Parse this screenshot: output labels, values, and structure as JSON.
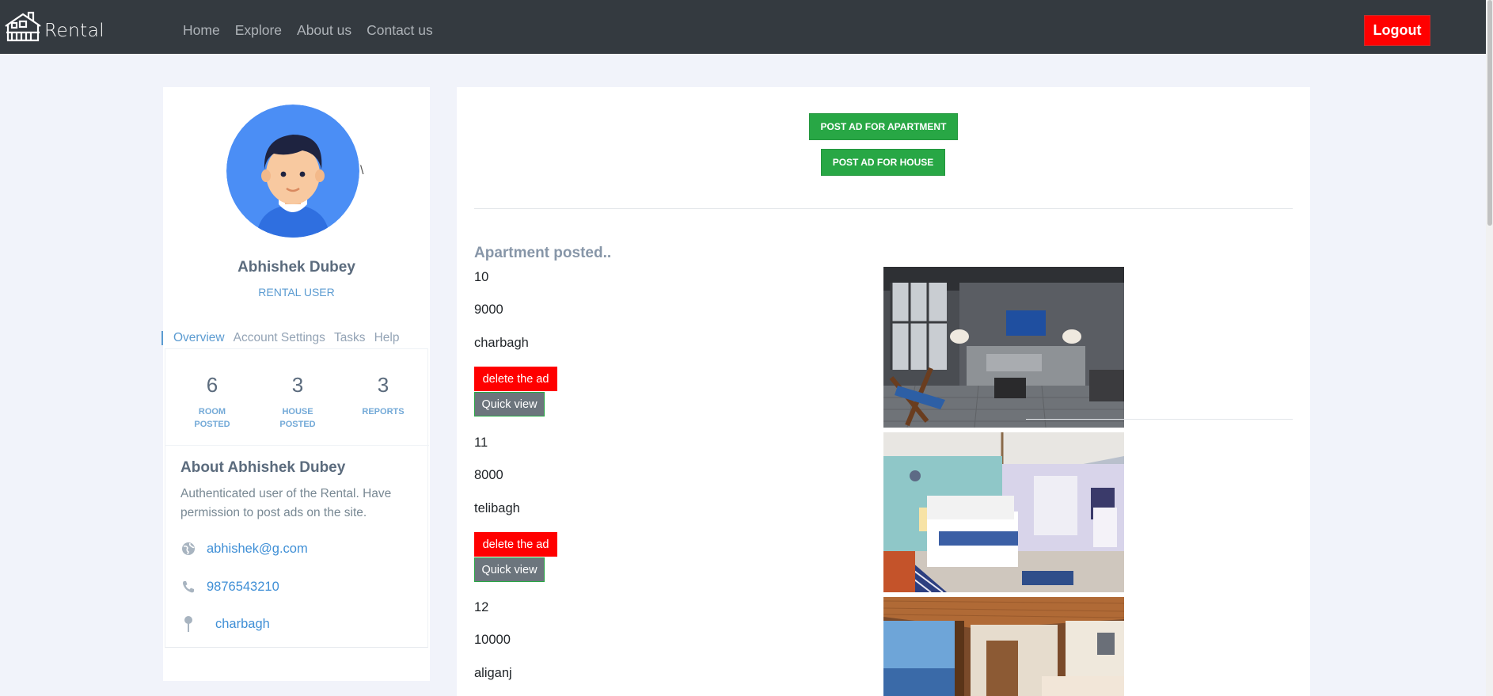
{
  "navbar": {
    "brand": "Rental",
    "links": [
      "Home",
      "Explore",
      "About us",
      "Contact us"
    ],
    "logout": "Logout"
  },
  "profile": {
    "mark": "\\",
    "name": "Abhishek Dubey",
    "role": "RENTAL USER",
    "menu": [
      "Overview",
      "Account Settings",
      "Tasks",
      "Help"
    ],
    "stats": [
      {
        "value": "6",
        "label_1": "ROOM",
        "label_2": "POSTED"
      },
      {
        "value": "3",
        "label_1": "HOUSE",
        "label_2": "POSTED"
      },
      {
        "value": "3",
        "label_1": "REPORTS",
        "label_2": ""
      }
    ],
    "about_title": "About Abhishek Dubey",
    "about_text": "Authenticated user of the Rental. Have permission to post ads on the site.",
    "email": "abhishek@g.com",
    "phone": "9876543210",
    "location": "charbagh"
  },
  "main": {
    "post_apartment": "POST AD FOR APARTMENT",
    "post_house": "POST AD FOR HOUSE",
    "section_title": "Apartment posted..",
    "delete_label": "delete the ad",
    "quick_label": "Quick view",
    "ads": [
      {
        "id": "10",
        "price": "9000",
        "location": "charbagh"
      },
      {
        "id": "11",
        "price": "8000",
        "location": "telibagh"
      },
      {
        "id": "12",
        "price": "10000",
        "location": "aliganj"
      }
    ]
  },
  "colors": {
    "navbar": "#343a40",
    "logout": "#ff0000",
    "post_buttons": "#28a745",
    "delete_button": "#ff0000",
    "quick_view_button": "#6c757d",
    "link_blue": "#3f8fd6"
  },
  "icons": [
    "house-logo-icon",
    "globe-icon",
    "phone-icon",
    "map-pin-icon"
  ]
}
